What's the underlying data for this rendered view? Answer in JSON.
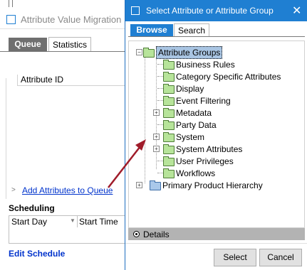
{
  "background_window": {
    "title": "Attribute Value Migration",
    "tabs": [
      {
        "label": "Queue"
      },
      {
        "label": "Statistics"
      }
    ],
    "list_header": "Attribute ID",
    "add_link": "Add Attributes to Queue",
    "scheduling_heading": "Scheduling",
    "columns": [
      "Start Day",
      "Start Time"
    ],
    "edit_link": "Edit Schedule"
  },
  "dialog": {
    "title": "Select Attribute or Attribute Group",
    "close_glyph": "✕",
    "tabs": [
      {
        "label": "Browse"
      },
      {
        "label": "Search"
      }
    ],
    "tree": {
      "root": {
        "label": "Attribute Groups",
        "expanded": true,
        "selected": true
      },
      "children": [
        {
          "label": "Business Rules",
          "expandable": false
        },
        {
          "label": "Category Specific Attributes",
          "expandable": false
        },
        {
          "label": "Display",
          "expandable": false
        },
        {
          "label": "Event Filtering",
          "expandable": false
        },
        {
          "label": "Metadata",
          "expandable": true
        },
        {
          "label": "Party Data",
          "expandable": false
        },
        {
          "label": "System",
          "expandable": true
        },
        {
          "label": "System Attributes",
          "expandable": true
        },
        {
          "label": "User Privileges",
          "expandable": false
        },
        {
          "label": "Workflows",
          "expandable": false
        }
      ],
      "second_root": {
        "label": "Primary Product Hierarchy",
        "expandable": true
      }
    },
    "details_label": "Details",
    "buttons": {
      "select": "Select",
      "cancel": "Cancel"
    }
  },
  "colors": {
    "accent": "#1f7fd2",
    "link": "#0033cc",
    "arrow": "#a01c2a",
    "folder_green": "#b7e49a",
    "folder_blue": "#a9c8ea",
    "selection": "#a9c5e3"
  }
}
